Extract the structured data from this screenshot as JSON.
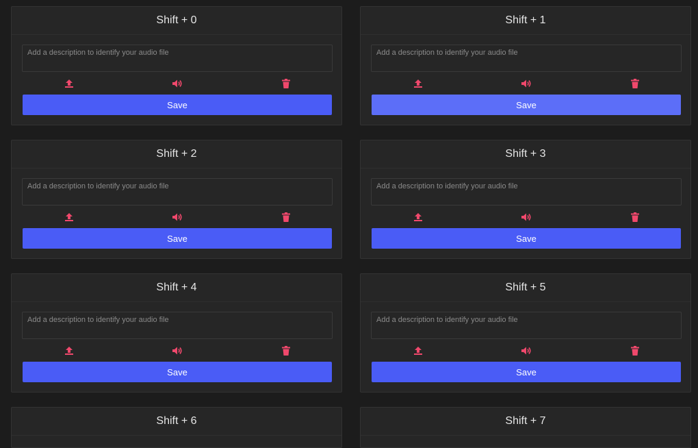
{
  "colors": {
    "background": "#1c1c1c",
    "card": "#262626",
    "accent": "#4a5cf6",
    "icon": "#f0486c"
  },
  "placeholder": "Add a description to identify your audio file",
  "save_label": "Save",
  "icons": [
    "upload-icon",
    "speaker-icon",
    "trash-icon"
  ],
  "cards": [
    {
      "title": "Shift + 0"
    },
    {
      "title": "Shift + 1"
    },
    {
      "title": "Shift + 2"
    },
    {
      "title": "Shift + 3"
    },
    {
      "title": "Shift + 4"
    },
    {
      "title": "Shift + 5"
    },
    {
      "title": "Shift + 6"
    },
    {
      "title": "Shift + 7"
    }
  ]
}
